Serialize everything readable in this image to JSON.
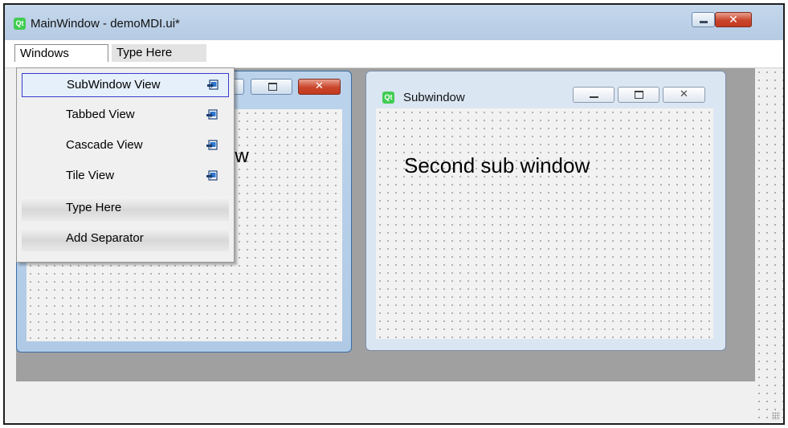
{
  "window": {
    "title": "MainWindow - demoMDI.ui*",
    "logo": "Qt",
    "close_glyph": "✕"
  },
  "menubar": {
    "items": [
      {
        "label": "Windows"
      },
      {
        "label": "Type Here"
      }
    ]
  },
  "windows_menu": {
    "items": [
      {
        "label": "SubWindow View",
        "icon": "action-icon",
        "selected": true
      },
      {
        "label": "Tabbed View",
        "icon": "action-icon"
      },
      {
        "label": "Cascade View",
        "icon": "action-icon"
      },
      {
        "label": "Tile View",
        "icon": "action-icon"
      },
      {
        "label": "Type Here"
      },
      {
        "label": "Add Separator"
      }
    ]
  },
  "subwindow1": {
    "content_text": "ow",
    "close_glyph": "✕"
  },
  "subwindow2": {
    "title": "Subwindow",
    "logo": "Qt",
    "content_text": "Second sub window",
    "close_glyph": "✕"
  },
  "colors": {
    "titlebar": "#b5cbe3",
    "close_button": "#c9452b",
    "mdi_background": "#a0a0a0",
    "selection_border": "#3a3ad0"
  }
}
